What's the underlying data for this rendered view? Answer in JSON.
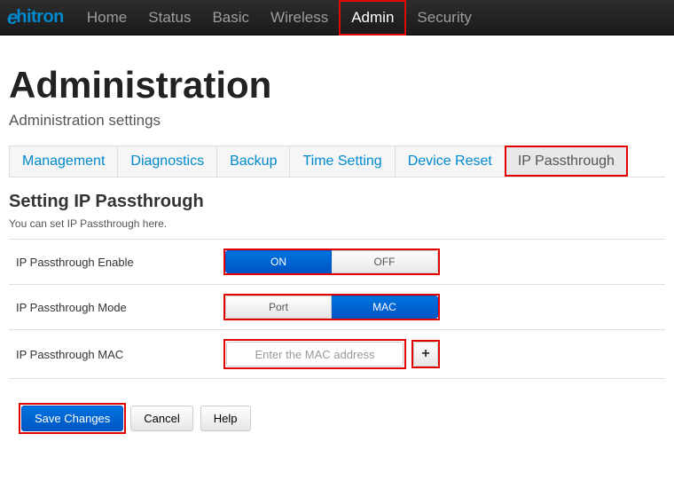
{
  "brand": "hitron",
  "nav": {
    "items": [
      {
        "label": "Home",
        "active": false,
        "highlighted": false
      },
      {
        "label": "Status",
        "active": false,
        "highlighted": false
      },
      {
        "label": "Basic",
        "active": false,
        "highlighted": false
      },
      {
        "label": "Wireless",
        "active": false,
        "highlighted": false
      },
      {
        "label": "Admin",
        "active": true,
        "highlighted": true
      },
      {
        "label": "Security",
        "active": false,
        "highlighted": false
      }
    ]
  },
  "page": {
    "title": "Administration",
    "subtitle": "Administration settings"
  },
  "tabs": [
    {
      "label": "Management",
      "active": false,
      "highlighted": false
    },
    {
      "label": "Diagnostics",
      "active": false,
      "highlighted": false
    },
    {
      "label": "Backup",
      "active": false,
      "highlighted": false
    },
    {
      "label": "Time Setting",
      "active": false,
      "highlighted": false
    },
    {
      "label": "Device Reset",
      "active": false,
      "highlighted": false
    },
    {
      "label": "IP Passthrough",
      "active": true,
      "highlighted": true
    }
  ],
  "section": {
    "title": "Setting IP Passthrough",
    "description": "You can set IP Passthrough here."
  },
  "settings": {
    "enable": {
      "label": "IP Passthrough Enable",
      "on": "ON",
      "off": "OFF",
      "selected": "ON"
    },
    "mode": {
      "label": "IP Passthrough Mode",
      "port": "Port",
      "mac": "MAC",
      "selected": "MAC"
    },
    "mac": {
      "label": "IP Passthrough MAC",
      "placeholder": "Enter the MAC address",
      "value": "",
      "add": "+"
    }
  },
  "footer": {
    "save": "Save Changes",
    "cancel": "Cancel",
    "help": "Help"
  }
}
